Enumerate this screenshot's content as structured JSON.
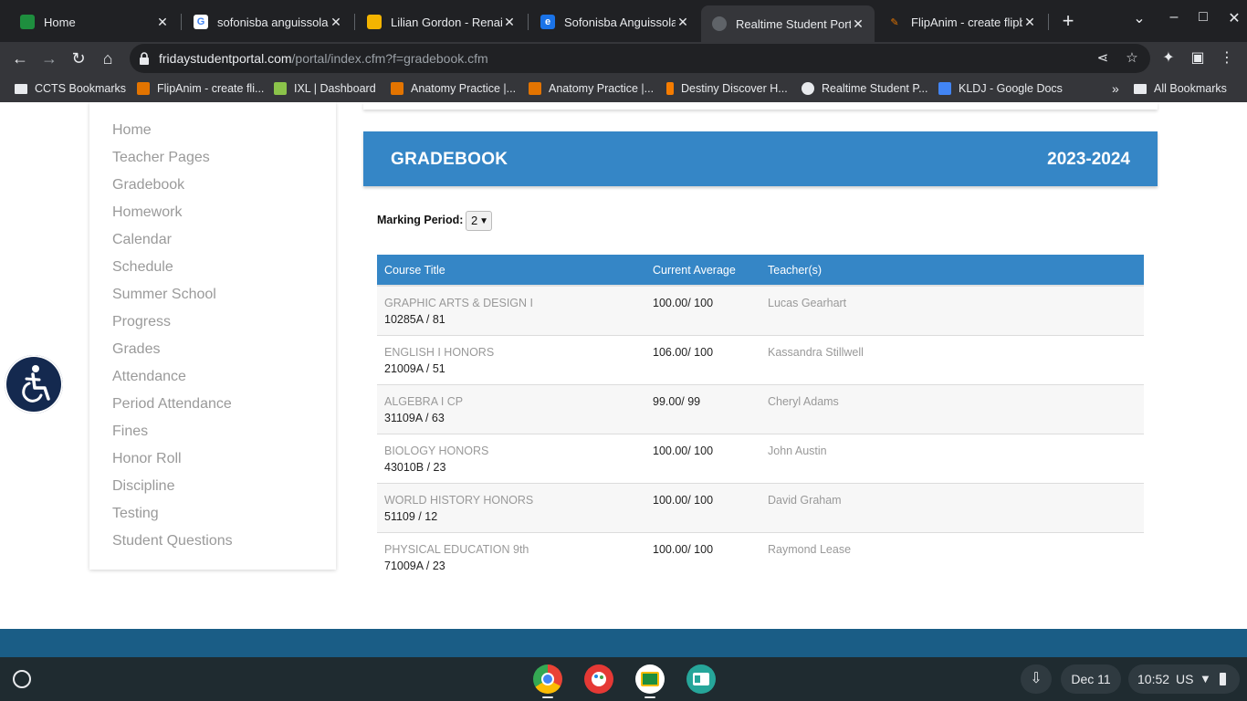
{
  "browser": {
    "tabs": [
      {
        "title": "Home",
        "favicon": "google-classroom-icon",
        "color": "#1e8e3e"
      },
      {
        "title": "sofonisba anguissola",
        "favicon": "google-icon",
        "color": "#ffffff"
      },
      {
        "title": "Lilian Gordon - Renaiss",
        "favicon": "google-slides-icon",
        "color": "#f4b400"
      },
      {
        "title": "Sofonisba Anguissola",
        "favicon": "edpuzzle-icon",
        "color": "#1a73e8"
      },
      {
        "title": "Realtime Student Porta",
        "favicon": "globe-icon",
        "color": "#9aa0a6"
      },
      {
        "title": "FlipAnim - create flipb",
        "favicon": "flipanim-icon",
        "color": "#e37400"
      }
    ],
    "url_host": "fridaystudentportal.com",
    "url_path": "/portal/index.cfm?f=gradebook.cfm",
    "bookmarks": [
      {
        "label": "CCTS Bookmarks",
        "icon": "folder-icon"
      },
      {
        "label": "FlipAnim - create fli...",
        "icon": "flipanim-icon"
      },
      {
        "label": "IXL | Dashboard",
        "icon": "ixl-icon"
      },
      {
        "label": "Anatomy Practice |...",
        "icon": "flipanim-icon"
      },
      {
        "label": "Anatomy Practice |...",
        "icon": "flipanim-icon"
      },
      {
        "label": "Destiny Discover H...",
        "icon": "destiny-icon"
      },
      {
        "label": "Realtime Student P...",
        "icon": "globe-icon"
      },
      {
        "label": "KLDJ - Google Docs",
        "icon": "google-docs-icon"
      }
    ],
    "all_bookmarks": "All Bookmarks"
  },
  "sidebar": {
    "items": [
      "Home",
      "Teacher Pages",
      "Gradebook",
      "Homework",
      "Calendar",
      "Schedule",
      "Summer School",
      "Progress",
      "Grades",
      "Attendance",
      "Period Attendance",
      "Fines",
      "Honor Roll",
      "Discipline",
      "Testing",
      "Student Questions"
    ]
  },
  "gradebook": {
    "title": "GRADEBOOK",
    "year": "2023-2024",
    "marking_period_label": "Marking Period:",
    "marking_period_value": "2",
    "columns": [
      "Course Title",
      "Current Average",
      "Teacher(s)"
    ],
    "rows": [
      {
        "course": "GRAPHIC ARTS & DESIGN I",
        "code": "10285A / 81",
        "average": "100.00/ 100",
        "teacher": "Lucas Gearhart"
      },
      {
        "course": "ENGLISH I HONORS",
        "code": "21009A / 51",
        "average": "106.00/ 100",
        "teacher": "Kassandra Stillwell"
      },
      {
        "course": "ALGEBRA I CP",
        "code": "31109A / 63",
        "average": "99.00/ 99",
        "teacher": "Cheryl Adams"
      },
      {
        "course": "BIOLOGY HONORS",
        "code": "43010B / 23",
        "average": "100.00/ 100",
        "teacher": "John Austin"
      },
      {
        "course": "WORLD HISTORY HONORS",
        "code": "51109 / 12",
        "average": "100.00/ 100",
        "teacher": "David Graham"
      },
      {
        "course": "PHYSICAL EDUCATION 9th",
        "code": "71009A / 23",
        "average": "100.00/ 100",
        "teacher": "Raymond Lease"
      }
    ]
  },
  "shelf": {
    "date": "Dec 11",
    "time": "10:52",
    "locale": "US",
    "apps": [
      "chrome-icon",
      "canvas-paint-icon",
      "google-classroom-icon",
      "news-icon"
    ]
  },
  "colors": {
    "header_blue": "#3586c6",
    "footer_blue": "#1a5d86",
    "accessibility_navy": "#14294f"
  }
}
